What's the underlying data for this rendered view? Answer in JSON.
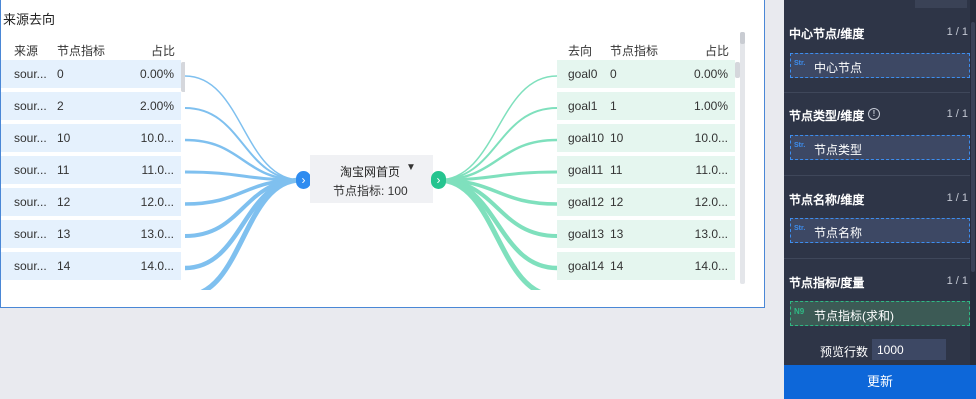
{
  "chart": {
    "title": "来源去向",
    "source_table": {
      "headers": [
        "来源",
        "节点指标",
        "占比"
      ],
      "rows": [
        {
          "name": "sour...",
          "metric": "0",
          "ratio": "0.00%"
        },
        {
          "name": "sour...",
          "metric": "2",
          "ratio": "2.00%"
        },
        {
          "name": "sour...",
          "metric": "10",
          "ratio": "10.0..."
        },
        {
          "name": "sour...",
          "metric": "11",
          "ratio": "11.0..."
        },
        {
          "name": "sour...",
          "metric": "12",
          "ratio": "12.0..."
        },
        {
          "name": "sour...",
          "metric": "13",
          "ratio": "13.0..."
        },
        {
          "name": "sour...",
          "metric": "14",
          "ratio": "14.0..."
        }
      ]
    },
    "target_table": {
      "headers": [
        "去向",
        "节点指标",
        "占比"
      ],
      "rows": [
        {
          "name": "goal0",
          "metric": "0",
          "ratio": "0.00%"
        },
        {
          "name": "goal1",
          "metric": "1",
          "ratio": "1.00%"
        },
        {
          "name": "goal10",
          "metric": "10",
          "ratio": "10.0..."
        },
        {
          "name": "goal11",
          "metric": "11",
          "ratio": "11.0..."
        },
        {
          "name": "goal12",
          "metric": "12",
          "ratio": "12.0..."
        },
        {
          "name": "goal13",
          "metric": "13",
          "ratio": "13.0..."
        },
        {
          "name": "goal14",
          "metric": "14",
          "ratio": "14.0..."
        }
      ]
    },
    "center_node": {
      "name": "淘宝网首页",
      "caret": "▼",
      "metric_text": "节点指标: 100"
    },
    "colors": {
      "source_flow": "#7fc0ef",
      "target_flow": "#7fe0bd",
      "source_row": "#e5f1fd",
      "target_row": "#e5f6ef"
    }
  },
  "panel": {
    "sections": [
      {
        "title": "中心节点/维度",
        "count": "1 / 1",
        "field": "中心节点",
        "field_type": "Str."
      },
      {
        "title": "节点类型/维度",
        "count": "1 / 1",
        "field": "节点类型",
        "field_type": "Str."
      },
      {
        "title": "节点名称/维度",
        "count": "1 / 1",
        "field": "节点名称",
        "field_type": "Str."
      },
      {
        "title": "节点指标/度量",
        "count": "1 / 1",
        "field": "节点指标(求和)",
        "field_type": "N9"
      }
    ],
    "info_icon": "!",
    "preview_label": "预览行数",
    "preview_value": "1000",
    "update_label": "更新"
  }
}
